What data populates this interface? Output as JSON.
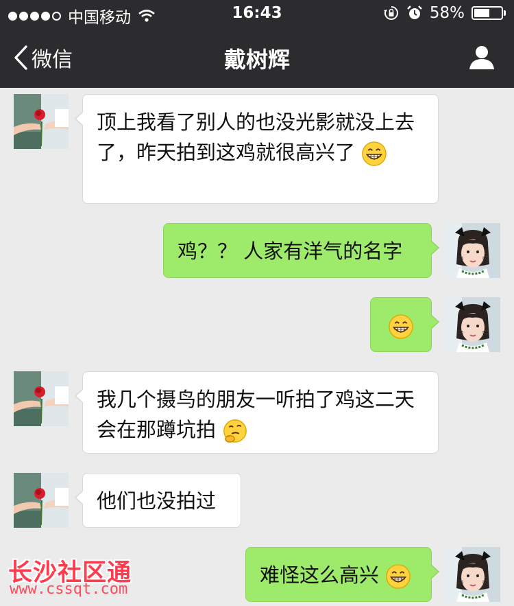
{
  "status_bar": {
    "carrier": "中国移动",
    "time": "16:43",
    "battery": "58%",
    "battery_level": 0.58
  },
  "nav": {
    "back_label": "微信",
    "title": "戴树辉"
  },
  "messages": [
    {
      "side": "in",
      "text": "顶上我看了别人的也没光影就没上去了，昨天拍到这鸡就很高兴了",
      "emoji": "grin-emoji"
    },
    {
      "side": "out",
      "text": "鸡？？ 人家有洋气的名字",
      "emoji": ""
    },
    {
      "side": "out",
      "text": "",
      "emoji": "grin-emoji"
    },
    {
      "side": "in",
      "text": "我几个摄鸟的朋友一听拍了鸡这二天会在那蹲坑拍",
      "emoji": "thinking-emoji"
    },
    {
      "side": "in",
      "text": "他们也没拍过",
      "emoji": ""
    },
    {
      "side": "out",
      "text": "难怪这么高兴",
      "emoji": "grin-emoji"
    }
  ],
  "watermark": {
    "name": "长沙社区通",
    "url": "www.cssqt.com"
  },
  "colors": {
    "bar_bg": "#2c2c2e",
    "chat_bg": "#ebebeb",
    "bubble_out": "#9eea6a",
    "bubble_in": "#ffffff",
    "watermark": "#ff3b4d"
  }
}
